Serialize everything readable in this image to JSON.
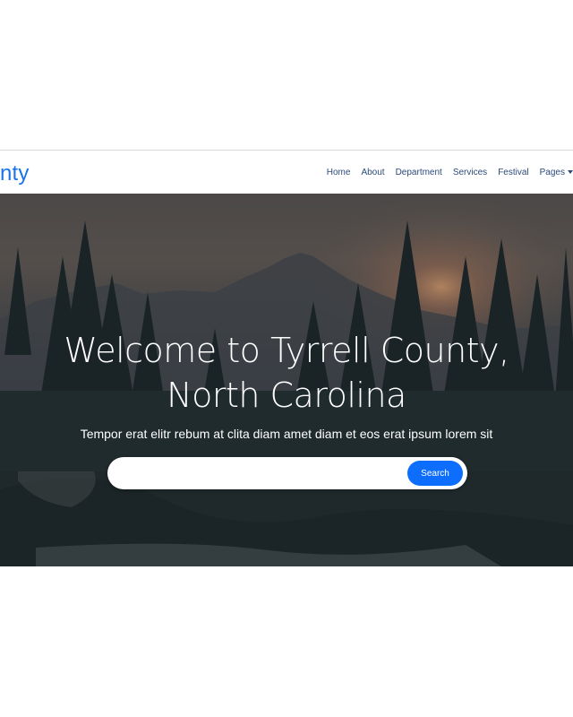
{
  "brand": {
    "text": "nty"
  },
  "nav": {
    "items": [
      {
        "label": "Home"
      },
      {
        "label": "About"
      },
      {
        "label": "Department"
      },
      {
        "label": "Services"
      },
      {
        "label": "Festival"
      },
      {
        "label": "Pages"
      }
    ]
  },
  "hero": {
    "title_line1": "Welcome to Tyrrell County,",
    "title_line2": "North Carolina",
    "subtitle": "Tempor erat elitr rebum at clita diam amet diam et eos erat ipsum lorem sit",
    "search": {
      "placeholder": "",
      "button_label": "Search"
    }
  },
  "colors": {
    "brand": "#1a73e8",
    "nav_text": "#2b4a7a",
    "button": "#0d6efd"
  }
}
